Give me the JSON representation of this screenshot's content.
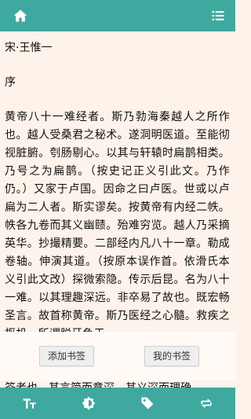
{
  "header": {
    "home_icon": "home-icon",
    "menu_icon": "list-menu-icon"
  },
  "document": {
    "author": "宋·王惟一",
    "section_title": "序",
    "body": "黄帝八十一难经者。斯乃勃海秦越人之所作也。越人受桑君之秘术。遂洞明医道。至能彻视脏腑。刳肠剔心。以其与轩辕时扁鹊相类。乃号之为扁鹊。（按史记正义引此文。乃作仍。）又家于卢国。因命之曰卢医。世或以卢扁为二人者。斯实谬矣。按黄帝有内经二帙。帙各九卷而其义幽赜。殆难穷览。越人乃采摘英华。抄撮精要。二部经内凡八十一章。勒成卷轴。伸演其道。（按原本误作首。依滑氏本义引此文改）探微索隐。传示后昆。名为八十一难。以其理趣深远。非卒易了故也。既宏畅圣言。故首称黄帝。斯乃医经之心髓。救疾之枢机。所谓脱牙鱼于",
    "peek_line": "筌者也。其言简而意深。其义深而理确"
  },
  "bookmarks": {
    "add_label": "添加书签",
    "mine_label": "我的书签"
  },
  "footer": {
    "tabs": [
      "text-size-icon",
      "brightness-icon",
      "tag-icon",
      "swap-icon"
    ]
  },
  "colors": {
    "bar": "#3fa9a0",
    "page": "#fdf3ea"
  }
}
